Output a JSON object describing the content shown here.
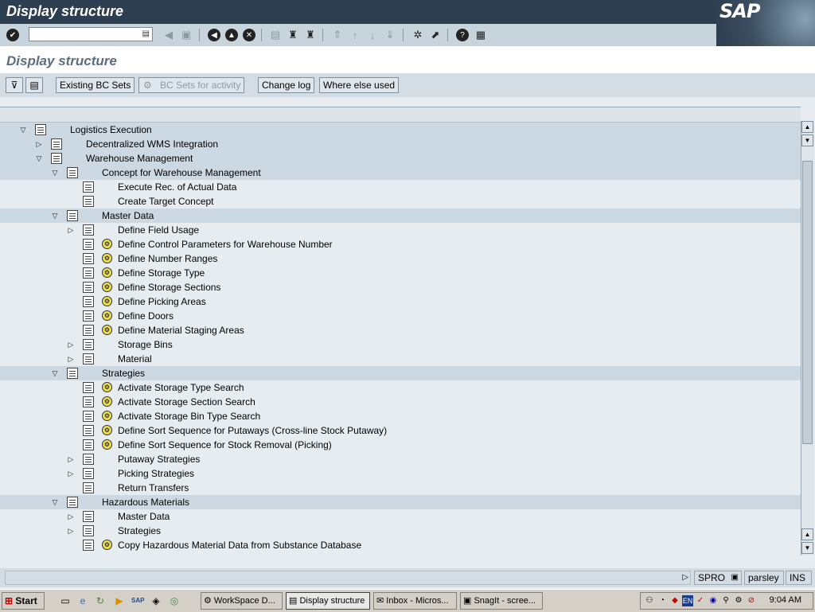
{
  "window": {
    "title": "Display structure",
    "logo": "SAP"
  },
  "std_toolbar": {
    "command_field": {
      "value": "",
      "placeholder": ""
    },
    "icons": [
      "enter-icon",
      "back-icon",
      "exit-icon",
      "cancel-icon",
      "print-icon",
      "find-icon",
      "find-next-icon",
      "first-page-icon",
      "prev-page-icon",
      "next-page-icon",
      "last-page-icon",
      "create-session-icon",
      "shortcut-icon",
      "help-icon",
      "layout-menu-icon"
    ]
  },
  "screen": {
    "title": "Display structure"
  },
  "app_toolbar": {
    "buttons": [
      {
        "label": "Existing BC Sets",
        "enabled": true
      },
      {
        "label": "BC Sets for activity",
        "enabled": false
      },
      {
        "label": "Change log",
        "enabled": true
      },
      {
        "label": "Where else used",
        "enabled": true
      }
    ]
  },
  "tree": {
    "rows": [
      {
        "label": "Logistics Execution",
        "level": 0,
        "expander": "expanded",
        "activity": false,
        "node": true
      },
      {
        "label": "Decentralized WMS Integration",
        "level": 1,
        "expander": "collapsed",
        "activity": false,
        "node": true
      },
      {
        "label": "Warehouse Management",
        "level": 1,
        "expander": "expanded",
        "activity": false,
        "node": true
      },
      {
        "label": "Concept for Warehouse Management",
        "level": 2,
        "expander": "expanded",
        "activity": false,
        "node": true
      },
      {
        "label": "Execute Rec. of Actual Data",
        "level": 3,
        "expander": "none",
        "activity": false,
        "node": false
      },
      {
        "label": "Create Target Concept",
        "level": 3,
        "expander": "none",
        "activity": false,
        "node": false
      },
      {
        "label": "Master Data",
        "level": 2,
        "expander": "expanded",
        "activity": false,
        "node": true
      },
      {
        "label": "Define Field Usage",
        "level": 3,
        "expander": "collapsed",
        "activity": false,
        "node": false
      },
      {
        "label": "Define Control Parameters for Warehouse Number",
        "level": 3,
        "expander": "none",
        "activity": true,
        "node": false
      },
      {
        "label": "Define Number Ranges",
        "level": 3,
        "expander": "none",
        "activity": true,
        "node": false
      },
      {
        "label": "Define Storage Type",
        "level": 3,
        "expander": "none",
        "activity": true,
        "node": false
      },
      {
        "label": "Define Storage Sections",
        "level": 3,
        "expander": "none",
        "activity": true,
        "node": false
      },
      {
        "label": "Define Picking Areas",
        "level": 3,
        "expander": "none",
        "activity": true,
        "node": false
      },
      {
        "label": "Define Doors",
        "level": 3,
        "expander": "none",
        "activity": true,
        "node": false
      },
      {
        "label": "Define Material Staging Areas",
        "level": 3,
        "expander": "none",
        "activity": true,
        "node": false
      },
      {
        "label": "Storage Bins",
        "level": 3,
        "expander": "collapsed",
        "activity": false,
        "node": false
      },
      {
        "label": "Material",
        "level": 3,
        "expander": "collapsed",
        "activity": false,
        "node": false
      },
      {
        "label": "Strategies",
        "level": 2,
        "expander": "expanded",
        "activity": false,
        "node": true
      },
      {
        "label": "Activate Storage Type Search",
        "level": 3,
        "expander": "none",
        "activity": true,
        "node": false
      },
      {
        "label": "Activate Storage Section Search",
        "level": 3,
        "expander": "none",
        "activity": true,
        "node": false
      },
      {
        "label": "Activate Storage Bin Type Search",
        "level": 3,
        "expander": "none",
        "activity": true,
        "node": false
      },
      {
        "label": "Define Sort Sequence for Putaways (Cross-line Stock Putaway)",
        "level": 3,
        "expander": "none",
        "activity": true,
        "node": false
      },
      {
        "label": "Define Sort Sequence for Stock Removal (Picking)",
        "level": 3,
        "expander": "none",
        "activity": true,
        "node": false
      },
      {
        "label": "Putaway Strategies",
        "level": 3,
        "expander": "collapsed",
        "activity": false,
        "node": false
      },
      {
        "label": "Picking Strategies",
        "level": 3,
        "expander": "collapsed",
        "activity": false,
        "node": false
      },
      {
        "label": "Return Transfers",
        "level": 3,
        "expander": "none",
        "activity": false,
        "node": false
      },
      {
        "label": "Hazardous Materials",
        "level": 2,
        "expander": "expanded",
        "activity": false,
        "node": true
      },
      {
        "label": "Master Data",
        "level": 3,
        "expander": "collapsed",
        "activity": false,
        "node": false
      },
      {
        "label": "Strategies",
        "level": 3,
        "expander": "collapsed",
        "activity": false,
        "node": false
      },
      {
        "label": "Copy Hazardous Material Data from Substance Database",
        "level": 3,
        "expander": "none",
        "activity": true,
        "node": false
      }
    ]
  },
  "status_bar": {
    "transaction": "SPRO",
    "server": "parsley",
    "mode": "INS"
  },
  "taskbar": {
    "start_label": "Start",
    "tasks": [
      {
        "label": "WorkSpace D...",
        "active": false
      },
      {
        "label": "Display structure",
        "active": true
      },
      {
        "label": "Inbox - Micros...",
        "active": false
      },
      {
        "label": "SnagIt - scree...",
        "active": false
      }
    ],
    "tray_language": "EN",
    "clock": "9:04 AM"
  }
}
